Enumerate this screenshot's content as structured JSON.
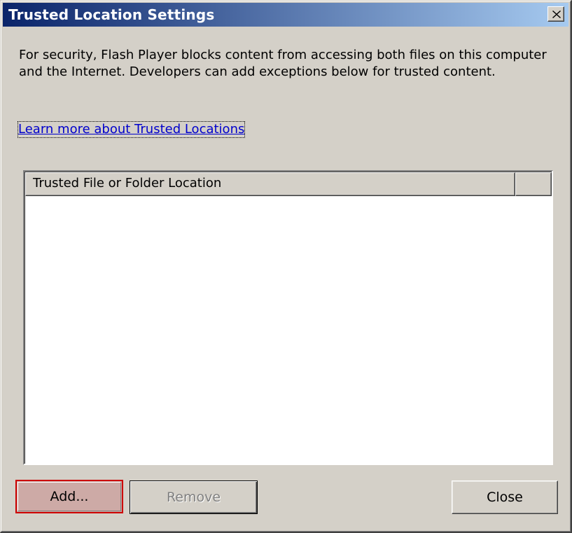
{
  "window": {
    "title": "Trusted Location Settings",
    "close_glyph": "✕"
  },
  "description": "For security, Flash Player blocks content from accessing both files on this computer and the Internet. Developers can add exceptions below for trusted content.",
  "learn_more_link": "Learn more about Trusted Locations",
  "list": {
    "columns": [
      "Trusted File or Folder Location",
      ""
    ],
    "rows": []
  },
  "buttons": {
    "add": "Add...",
    "remove": "Remove",
    "close": "Close"
  },
  "colors": {
    "title_gradient_start": "#0a246a",
    "title_gradient_end": "#a6caf0",
    "dialog_face": "#d4d0c8",
    "link": "#0000cc",
    "add_highlight_border": "#cc0000"
  },
  "icons": {
    "title_close": "close-icon"
  }
}
